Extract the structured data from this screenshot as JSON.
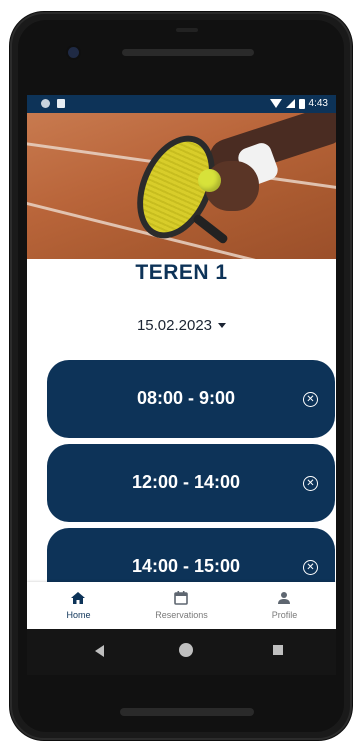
{
  "status_bar": {
    "time": "4:43"
  },
  "court": {
    "title": "TEREN 1",
    "date": "15.02.2023"
  },
  "slots": [
    {
      "label": "08:00 - 9:00"
    },
    {
      "label": "12:00 - 14:00"
    },
    {
      "label": "14:00 - 15:00"
    }
  ],
  "bottom_nav": {
    "items": [
      {
        "label": "Home",
        "icon": "home-icon",
        "active": true
      },
      {
        "label": "Reservations",
        "icon": "calendar-icon",
        "active": false
      },
      {
        "label": "Profile",
        "icon": "person-icon",
        "active": false
      }
    ]
  },
  "colors": {
    "primary": "#0d3358",
    "active_nav": "#0d3358",
    "inactive_nav": "#7a7a7a"
  }
}
